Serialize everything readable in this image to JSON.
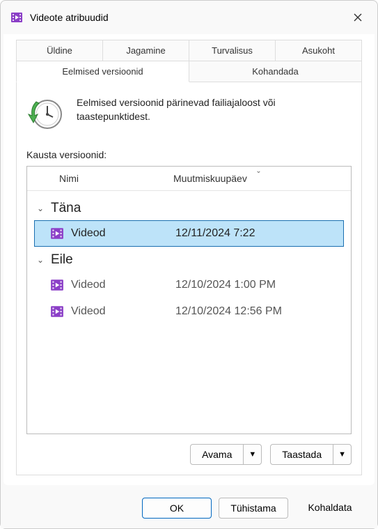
{
  "window": {
    "title": "Videote atribuudid"
  },
  "tabs": {
    "row1": [
      "Üldine",
      "Jagamine",
      "Turvalisus",
      "Asukoht"
    ],
    "row2": [
      "Eelmised versioonid",
      "Kohandada"
    ],
    "active": "Eelmised versioonid"
  },
  "info": {
    "text": "Eelmised versioonid pärinevad failiajaloost või taastepunktidest."
  },
  "list": {
    "label": "Kausta versioonid:",
    "columns": {
      "name": "Nimi",
      "date": "Muutmiskuupäev"
    },
    "groups": [
      {
        "label": "Täna",
        "items": [
          {
            "name": "Videod",
            "date": "12/11/2024 7:22",
            "selected": true
          }
        ]
      },
      {
        "label": "Eile",
        "items": [
          {
            "name": "Videod",
            "date": "12/10/2024 1:00 PM",
            "selected": false
          },
          {
            "name": "Videod",
            "date": "12/10/2024 12:56 PM",
            "selected": false
          }
        ]
      }
    ]
  },
  "actions": {
    "open": "Avama",
    "restore": "Taastada"
  },
  "buttons": {
    "ok": "OK",
    "cancel": "Tühistama",
    "apply": "Kohaldata"
  },
  "icons": {
    "folder_color": "#8b3fc7"
  }
}
